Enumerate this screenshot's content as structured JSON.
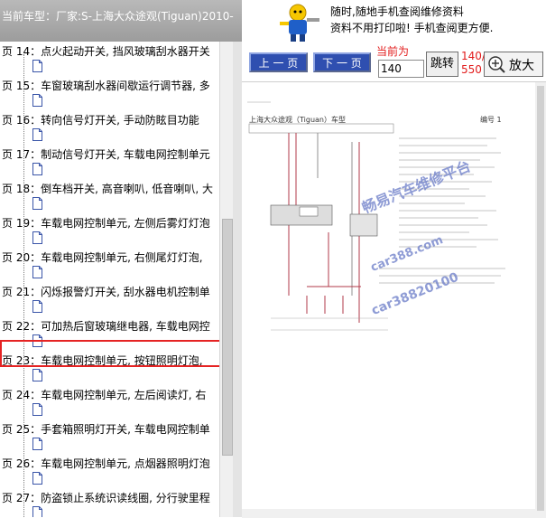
{
  "header": {
    "title": "当前车型：厂家:S-上海大众途观(Tiguan)2010-",
    "ad_line1": "随时,随地手机查阅维修资料",
    "ad_line2": "资料不用打印啦! 手机查阅更方便."
  },
  "tree": {
    "items": [
      {
        "label": "页 14：点火起动开关, 挡风玻璃刮水器开关"
      },
      {
        "label": "页 15：车窗玻璃刮水器间歇运行调节器, 多"
      },
      {
        "label": "页 16：转向信号灯开关, 手动防眩目功能"
      },
      {
        "label": "页 17：制动信号灯开关, 车载电网控制单元"
      },
      {
        "label": "页 18：倒车档开关, 高音喇叭, 低音喇叭, 大"
      },
      {
        "label": "页 19：车载电网控制单元, 左侧后雾灯灯泡"
      },
      {
        "label": "页 20：车载电网控制单元, 右侧尾灯灯泡,"
      },
      {
        "label": "页 21：闪烁报警灯开关, 刮水器电机控制单"
      },
      {
        "label": "页 22：可加热后窗玻璃继电器, 车载电网控"
      },
      {
        "label": "页 23：车载电网控制单元, 按钮照明灯泡,"
      },
      {
        "label": "页 24：车载电网控制单元, 左后阅读灯, 右"
      },
      {
        "label": "页 25：手套箱照明灯开关, 车载电网控制单"
      },
      {
        "label": "页 26：车载电网控制单元, 点烟器照明灯泡"
      },
      {
        "label": "页 27：防盗锁止系统识读线圈, 分行驶里程"
      }
    ],
    "selected_index": 9
  },
  "viewer": {
    "prev_label": "上 一 页",
    "next_label": "下 一 页",
    "current_page_label": "当前为",
    "page_input_value": "140",
    "jump_label": "跳转",
    "page_current": "140/",
    "page_total": "550",
    "zoom_label": "放大",
    "doc_header_left": "上海大众途观（Tiguan）车型",
    "doc_header_right": "编号 1",
    "watermark1": "畅易汽车维修平台",
    "watermark2": "car388.com",
    "watermark3": "car38820100"
  },
  "colors": {
    "nav_button": "#2f4fb0",
    "highlight": "#e52323",
    "page_label": "#e21b1b",
    "watermark": "#6a7cc8",
    "wire_red": "#b23a48"
  }
}
